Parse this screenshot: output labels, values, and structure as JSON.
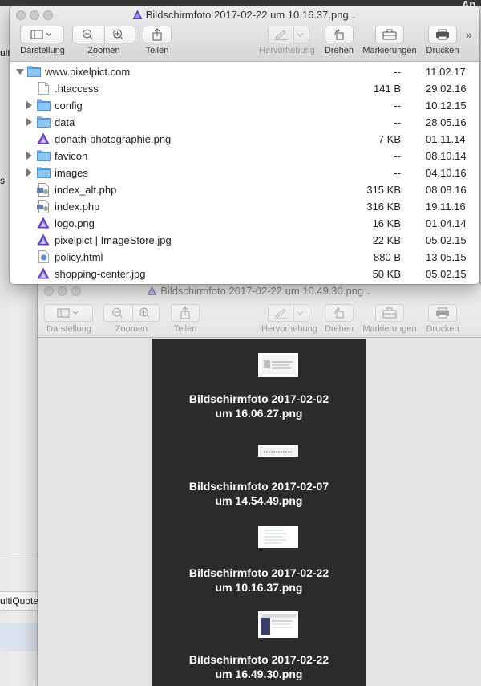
{
  "background": {
    "left_text_top": "ult",
    "left_text_mid": "s",
    "left_text_quote": "ultiQuote",
    "right_text_top": "Ap"
  },
  "front_window": {
    "title": "Bildschirmfoto 2017-02-22 um 10.16.37.png",
    "toolbar": {
      "darstellung": "Darstellung",
      "zoomen": "Zoomen",
      "teilen": "Teilen",
      "hervorhebung": "Hervorhebung",
      "drehen": "Drehen",
      "markierungen": "Markierungen",
      "drucken": "Drucken",
      "more": "»"
    },
    "rows": [
      {
        "name": "www.pixelpict.com",
        "size": "--",
        "date": "11.02.17",
        "icon": "folder-icon",
        "disclosure": "down",
        "indent": 0
      },
      {
        "name": ".htaccess",
        "size": "141 B",
        "date": "29.02.16",
        "icon": "document-icon",
        "disclosure": "none",
        "indent": 1
      },
      {
        "name": "config",
        "size": "--",
        "date": "10.12.15",
        "icon": "folder-icon",
        "disclosure": "right",
        "indent": 1
      },
      {
        "name": "data",
        "size": "--",
        "date": "28.05.16",
        "icon": "folder-icon",
        "disclosure": "right",
        "indent": 1
      },
      {
        "name": "donath-photographie.png",
        "size": "7 KB",
        "date": "01.11.14",
        "icon": "affinity-image-icon",
        "disclosure": "none",
        "indent": 1
      },
      {
        "name": "favicon",
        "size": "--",
        "date": "08.10.14",
        "icon": "folder-icon",
        "disclosure": "right",
        "indent": 1
      },
      {
        "name": "images",
        "size": "--",
        "date": "04.10.16",
        "icon": "folder-icon",
        "disclosure": "right",
        "indent": 1
      },
      {
        "name": "index_alt.php",
        "size": "315 KB",
        "date": "08.08.16",
        "icon": "php-file-icon",
        "disclosure": "none",
        "indent": 1
      },
      {
        "name": "index.php",
        "size": "316 KB",
        "date": "19.11.16",
        "icon": "php-file-icon",
        "disclosure": "none",
        "indent": 1
      },
      {
        "name": "logo.png",
        "size": "16 KB",
        "date": "01.04.14",
        "icon": "affinity-image-icon",
        "disclosure": "none",
        "indent": 1
      },
      {
        "name": "pixelpict | ImageStore.jpg",
        "size": "22 KB",
        "date": "05.02.15",
        "icon": "affinity-image-icon",
        "disclosure": "none",
        "indent": 1
      },
      {
        "name": "policy.html",
        "size": "880 B",
        "date": "13.05.15",
        "icon": "html-file-icon",
        "disclosure": "none",
        "indent": 1
      },
      {
        "name": "shopping-center.jpg",
        "size": "50 KB",
        "date": "05.02.15",
        "icon": "affinity-image-icon",
        "disclosure": "none",
        "indent": 1
      }
    ]
  },
  "back_window": {
    "title": "Bildschirmfoto 2017-02-22 um 16.49.30.png",
    "toolbar": {
      "darstellung": "Darstellung",
      "zoomen": "Zoomen",
      "teilen": "Teilen",
      "hervorhebung": "Hervorhebung",
      "drehen": "Drehen",
      "markierungen": "Markierungen",
      "drucken": "Drucken"
    },
    "thumbnails": [
      {
        "line1": "Bildschirmfoto 2017-02-02",
        "line2": "um 16.06.27.png"
      },
      {
        "line1": "Bildschirmfoto 2017-02-07",
        "line2": "um 14.54.49.png"
      },
      {
        "line1": "Bildschirmfoto 2017-02-22",
        "line2": "um 10.16.37.png"
      },
      {
        "line1": "Bildschirmfoto 2017-02-22",
        "line2": "um 16.49.30.png"
      }
    ]
  },
  "colors": {
    "folder_blue": "#6fb6f0",
    "affinity_purple": "#5b3fc4",
    "sidebar_dark": "#2b2b2b"
  }
}
